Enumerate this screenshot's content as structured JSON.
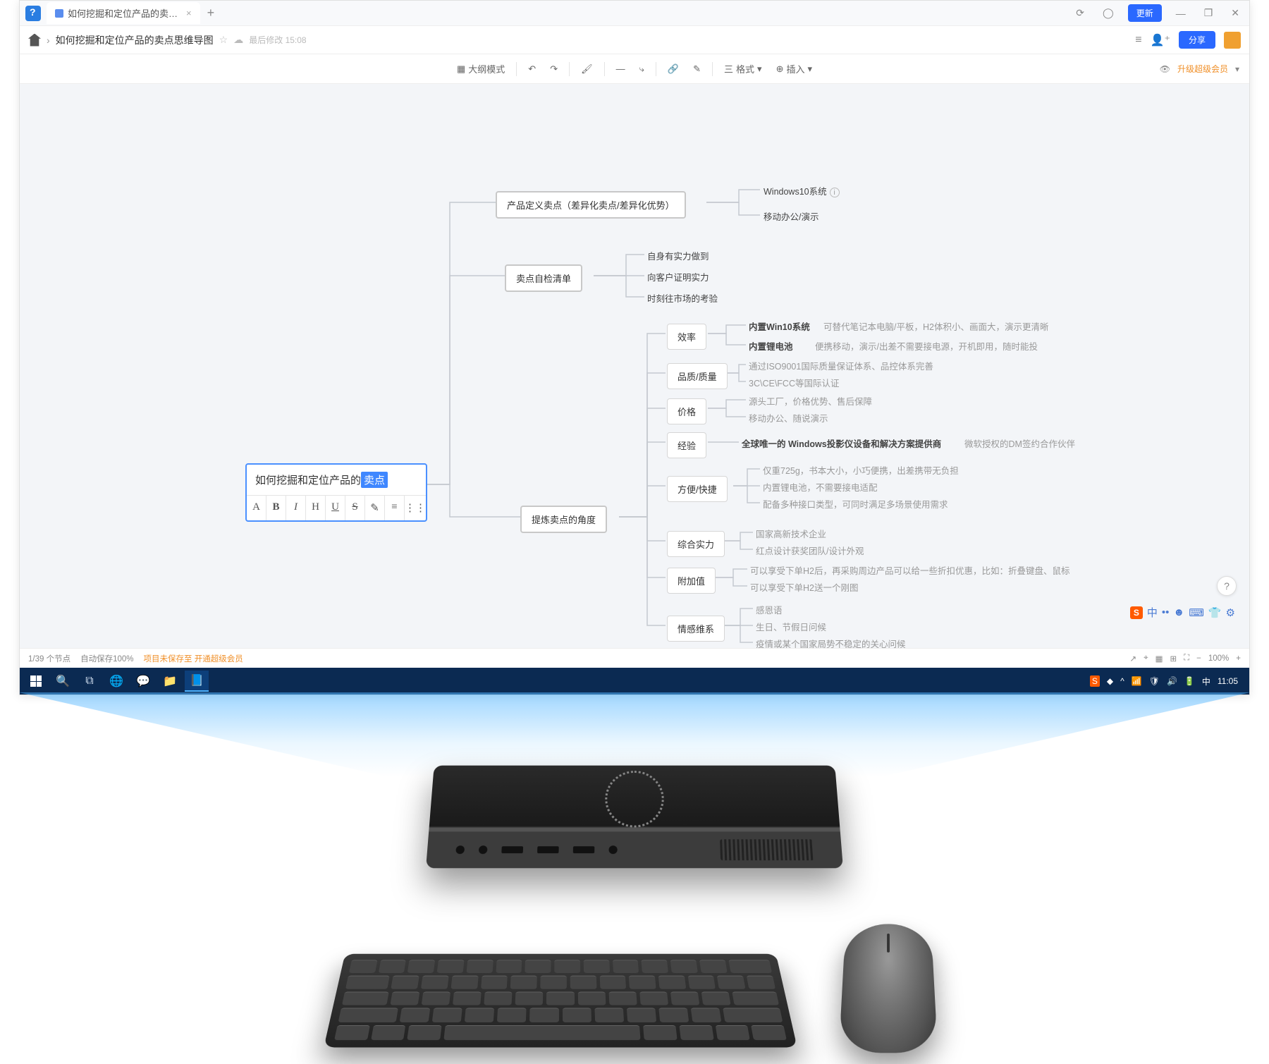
{
  "tab": {
    "title": "如何挖掘和定位产品的卖…"
  },
  "doc": {
    "title": "如何挖掘和定位产品的卖点思维导图",
    "mod_time": "最后修改 15:08"
  },
  "titlebar": {
    "update_btn": "更新"
  },
  "header": {
    "share_btn": "分享"
  },
  "toolbar": {
    "outline_mode": "大纲模式",
    "format": "格式",
    "insert": "插入",
    "upgrade": "升级超级会员"
  },
  "mindmap": {
    "root_prefix": "如何挖掘和定位产品的",
    "root_selected": "卖点",
    "fmt": {
      "a": "A",
      "b": "B",
      "i": "I",
      "h": "H",
      "u": "U",
      "s": "S",
      "pen": "✎",
      "ol": "≡",
      "ul": "⋮⋮"
    },
    "b1": {
      "label": "产品定义卖点（差异化卖点/差异化优势）",
      "leaf1": "Windows10系统",
      "leaf2": "移动办公/演示"
    },
    "b2": {
      "label": "卖点自检清单",
      "leaf1": "自身有实力做到",
      "leaf2": "向客户证明实力",
      "leaf3": "时刻往市场的考验"
    },
    "b3": {
      "label": "提炼卖点的角度",
      "eff": {
        "label": "效率",
        "l1a": "内置Win10系统",
        "l1b": "可替代笔记本电脑/平板，H2体积小、画面大，演示更清晰",
        "l2a": "内置锂电池",
        "l2b": "便携移动，演示/出差不需要接电源，开机即用，随时能投"
      },
      "qual": {
        "label": "品质/质量",
        "l1": "通过ISO9001国际质量保证体系、品控体系完善",
        "l2": "3C\\CE\\FCC等国际认证"
      },
      "price": {
        "label": "价格",
        "l1": "源头工厂，价格优势、售后保障",
        "l2": "移动办公、随说演示"
      },
      "exp": {
        "label": "经验",
        "l1": "全球唯一的 Windows投影仪设备和解决方案提供商",
        "l1b": "微软授权的DM签约合作伙伴"
      },
      "conv": {
        "label": "方便/快捷",
        "l1": "仅重725g，书本大小，小巧便携，出差携带无负担",
        "l2": "内置锂电池，不需要接电适配",
        "l3": "配备多种接口类型，可同时满足多场景使用需求"
      },
      "strength": {
        "label": "综合实力",
        "l1": "国家高新技术企业",
        "l2": "红点设计获奖团队/设计外观"
      },
      "add": {
        "label": "附加值",
        "l1": "可以享受下单H2后，再采购周边产品可以给一些折扣优惠，比如：折叠键盘、鼠标",
        "l2": "可以享受下单H2送一个刚图"
      },
      "emo": {
        "label": "情感维系",
        "l1": "感恩语",
        "l2": "生日、节假日问候",
        "l3": "疫情或某个国家局势不稳定的关心问候"
      }
    }
  },
  "status": {
    "nodes": "1/39 个节点",
    "save": "自动保存100%",
    "disk": "项目未保存至 开通超级会员",
    "zoom": "100%"
  },
  "taskbar": {
    "time": "11:05"
  }
}
